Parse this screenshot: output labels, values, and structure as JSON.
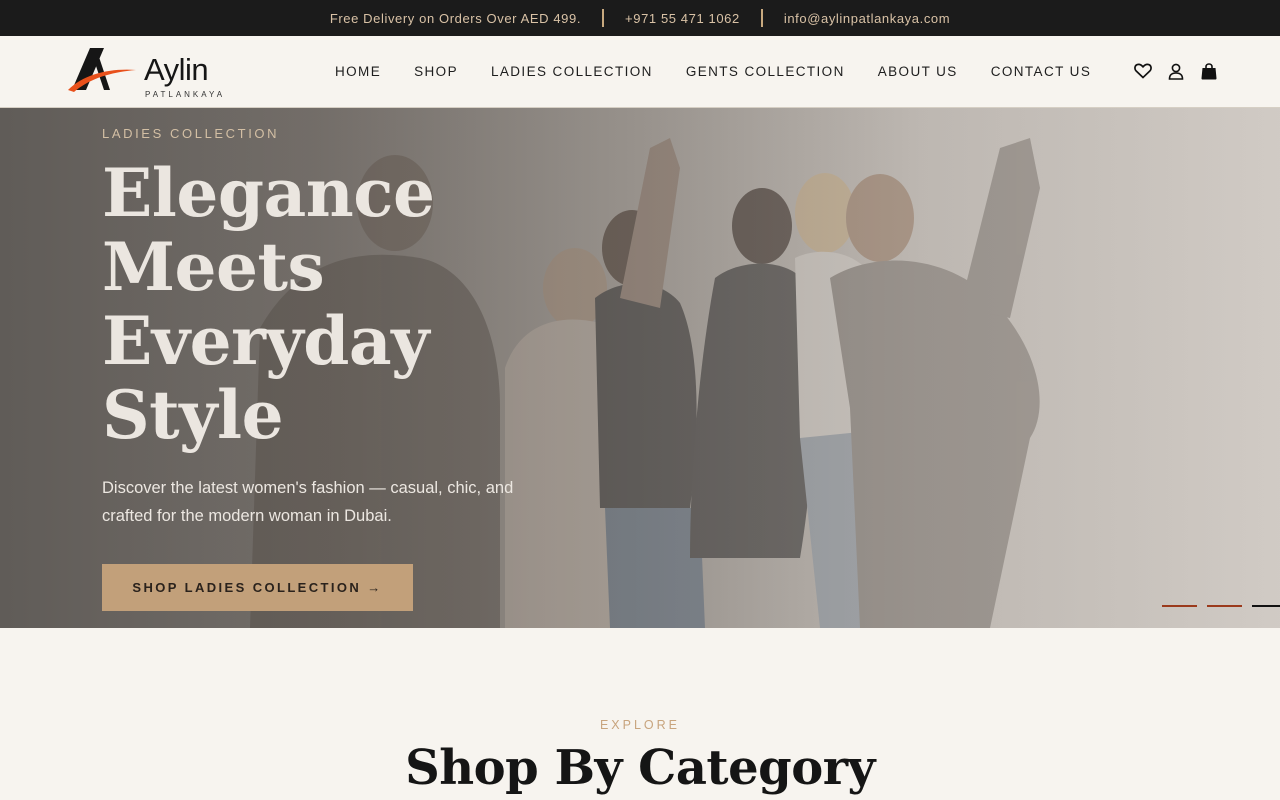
{
  "topbar": {
    "promo": "Free Delivery on Orders Over AED 499.",
    "phone": "+971 55 471 1062",
    "email": "info@aylinpatlankaya.com"
  },
  "brand": {
    "name": "Aylin",
    "sub": "PATLANKAYA",
    "accent": "#e8501b"
  },
  "nav": {
    "items": [
      "HOME",
      "SHOP",
      "LADIES COLLECTION",
      "GENTS COLLECTION",
      "ABOUT US",
      "CONTACT US"
    ]
  },
  "header_icons": [
    "heart-icon",
    "user-icon",
    "bag-icon"
  ],
  "hero": {
    "eyebrow": "LADIES COLLECTION",
    "title_lines": [
      "Elegance",
      "Meets",
      "Everyday",
      "Style"
    ],
    "description": "Discover the latest women's fashion — casual, chic, and crafted for the modern woman in Dubai.",
    "cta": "SHOP LADIES COLLECTION →",
    "slide_count": 3,
    "active_slide": 3,
    "colors": {
      "button": "#c2a07a",
      "dot_inactive": "#9b3a1c",
      "dot_active": "#111111"
    }
  },
  "category_section": {
    "eyebrow": "EXPLORE",
    "title": "Shop By Category"
  }
}
